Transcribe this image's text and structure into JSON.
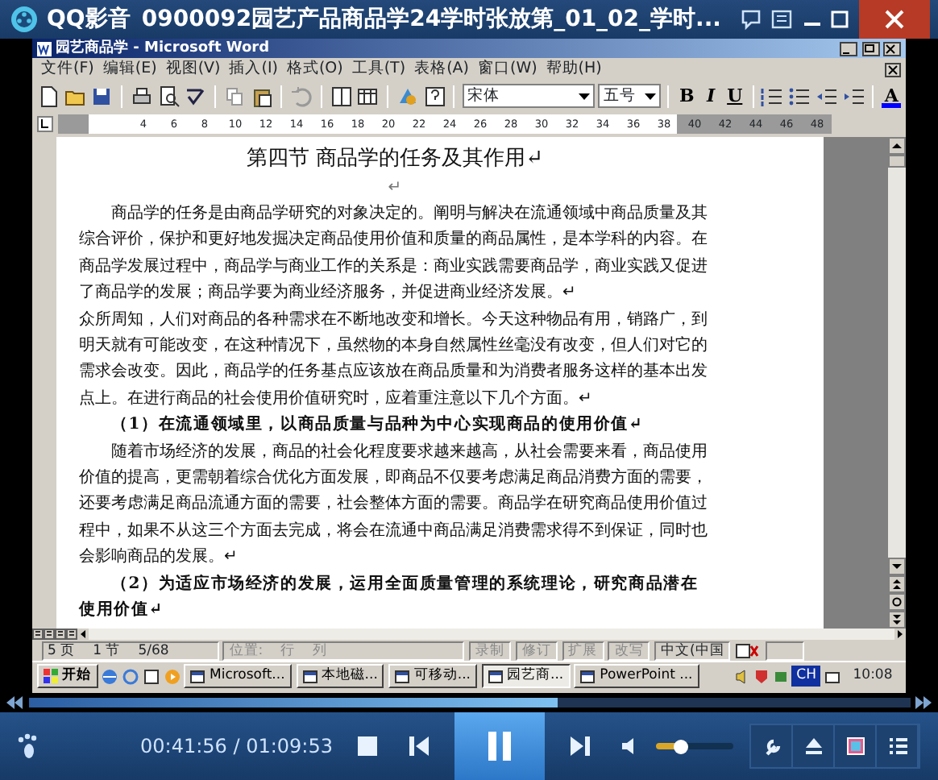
{
  "player": {
    "app_name": "QQ影音",
    "title": "0900092园艺产品商品学24学时张放第_01_02_学时...",
    "time": "00:41:56 / 01:09:53",
    "seek": {
      "level": 0.6
    },
    "volume": {
      "level": 0.3
    },
    "playing": true
  },
  "word": {
    "title": "园艺商品学 - Microsoft Word",
    "menu": [
      "文件(F)",
      "编辑(E)",
      "视图(V)",
      "插入(I)",
      "格式(O)",
      "工具(T)",
      "表格(A)",
      "窗口(W)",
      "帮助(H)"
    ],
    "toolbar": {
      "font": "宋体",
      "size": "五号",
      "format_buttons": [
        "B",
        "I",
        "U"
      ],
      "font_color_button": "A"
    },
    "ruler_ticks": [
      "4",
      "6",
      "8",
      "10",
      "12",
      "14",
      "16",
      "18",
      "20",
      "22",
      "24",
      "26",
      "28",
      "30",
      "32",
      "34",
      "36",
      "38",
      "40",
      "42",
      "44",
      "46",
      "48"
    ],
    "paragraphs": [
      {
        "kind": "heading",
        "text": "第四节  商品学的任务及其作用↵"
      },
      {
        "kind": "blank",
        "text": "↵"
      },
      {
        "kind": "body",
        "indent": true,
        "text": "商品学的任务是由商品学研究的对象决定的。阐明与解决在流通领域中商品质量及其综合评价，保护和更好地发掘决定商品使用价值和质量的商品属性，是本学科的内容。在商品学发展过程中，商品学与商业工作的关系是：商业实践需要商品学，商业实践又促进了商品学的发展；商品学要为商业经济服务，并促进商业经济发展。↵"
      },
      {
        "kind": "body",
        "indent": false,
        "text": "众所周知，人们对商品的各种需求在不断地改变和增长。今天这种物品有用，销路广，到明天就有可能改变，在这种情况下，虽然物的本身自然属性丝毫没有改变，但人们对它的需求会改变。因此，商品学的任务基点应该放在商品质量和为消费者服务这样的基本出发点上。在进行商品的社会使用价值研究时，应着重注意以下几个方面。↵"
      },
      {
        "kind": "subheading",
        "text": "（1）在流通领域里，以商品质量与品种为中心实现商品的使用价值↵"
      },
      {
        "kind": "body",
        "indent": true,
        "text": "随着市场经济的发展，商品的社会化程度要求越来越高，从社会需要来看，商品使用价值的提高，更需朝着综合优化方面发展，即商品不仅要考虑满足商品消费方面的需要，还要考虑满足商品流通方面的需要，社会整体方面的需要。商品学在研究商品使用价值过程中，如果不从这三个方面去完成，将会在流通中商品满足消费需求得不到保证，同时也会影响商品的发展。↵"
      },
      {
        "kind": "subheading",
        "text": "（2）为适应市场经济的发展，运用全面质量管理的系统理论，研究商品潜在使用价值↵"
      }
    ],
    "status_bar": [
      {
        "items": [
          {
            "text": "5 页",
            "disabled": false
          },
          {
            "text": "1 节",
            "disabled": false
          },
          {
            "text": "5/68",
            "disabled": false
          }
        ]
      },
      {
        "items": [
          {
            "text": "位置:",
            "disabled": true
          },
          {
            "text": "行",
            "disabled": true
          },
          {
            "text": "列",
            "disabled": true
          }
        ]
      },
      {
        "items": [
          {
            "text": "录制",
            "disabled": true
          }
        ]
      },
      {
        "items": [
          {
            "text": "修订",
            "disabled": true
          }
        ]
      },
      {
        "items": [
          {
            "text": "扩展",
            "disabled": true
          }
        ]
      },
      {
        "items": [
          {
            "text": "改写",
            "disabled": true
          }
        ]
      },
      {
        "items": [
          {
            "text": "中文(中国",
            "disabled": false
          }
        ]
      }
    ]
  },
  "taskbar": {
    "start": "开始",
    "tasks": [
      {
        "label": "Microsoft...",
        "selected": false
      },
      {
        "label": "本地磁...",
        "selected": false
      },
      {
        "label": "可移动...",
        "selected": false
      },
      {
        "label": "园艺商...",
        "selected": true
      },
      {
        "label": "PowerPoint ...",
        "selected": false
      }
    ],
    "tray_language": "CH",
    "clock": "10:08"
  }
}
